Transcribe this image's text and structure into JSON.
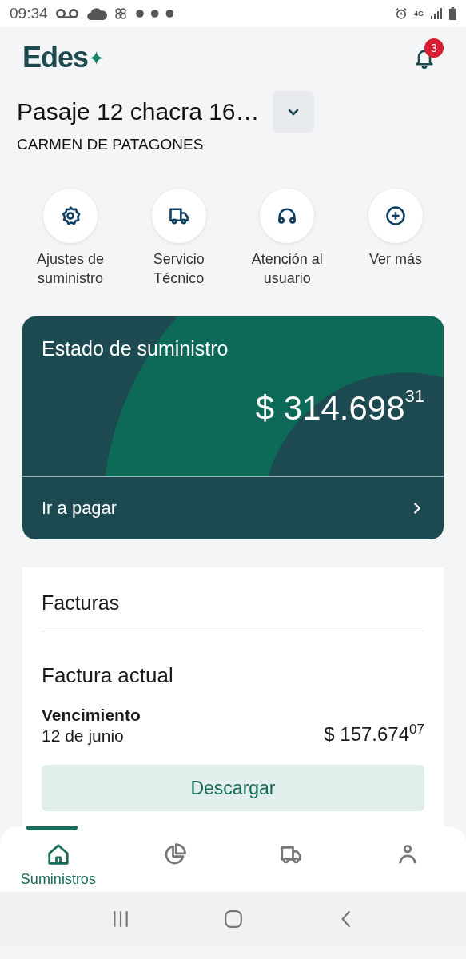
{
  "status_bar": {
    "time": "09:34",
    "network": "4G"
  },
  "header": {
    "logo": "Edes",
    "notifications": "3"
  },
  "supply": {
    "address": "Pasaje 12 chacra 16…",
    "city": "CARMEN DE PATAGONES"
  },
  "actions": [
    {
      "kind": "gear",
      "label": "Ajustes de suministro"
    },
    {
      "kind": "truck",
      "label": "Servicio Técnico"
    },
    {
      "kind": "headset",
      "label": "Atención al usuario"
    },
    {
      "kind": "plus",
      "label": "Ver más"
    }
  ],
  "balance_card": {
    "title": "Estado de suministro",
    "amount": "$ 314.698$^{31}$",
    "pay_link": "Ir a pagar"
  },
  "invoices": {
    "title": "Facturas",
    "section": "Factura actual",
    "due_label": "Vencimiento",
    "due_date": "12 de junio",
    "amount": "$ 157.674$^{07}$",
    "download": "Descargar"
  },
  "bottom_nav": [
    {
      "kind": "home",
      "label": "Suministros",
      "selected": true
    },
    {
      "kind": "chart",
      "selected": false
    },
    {
      "kind": "truck",
      "selected": false
    },
    {
      "kind": "user",
      "selected": false
    }
  ]
}
